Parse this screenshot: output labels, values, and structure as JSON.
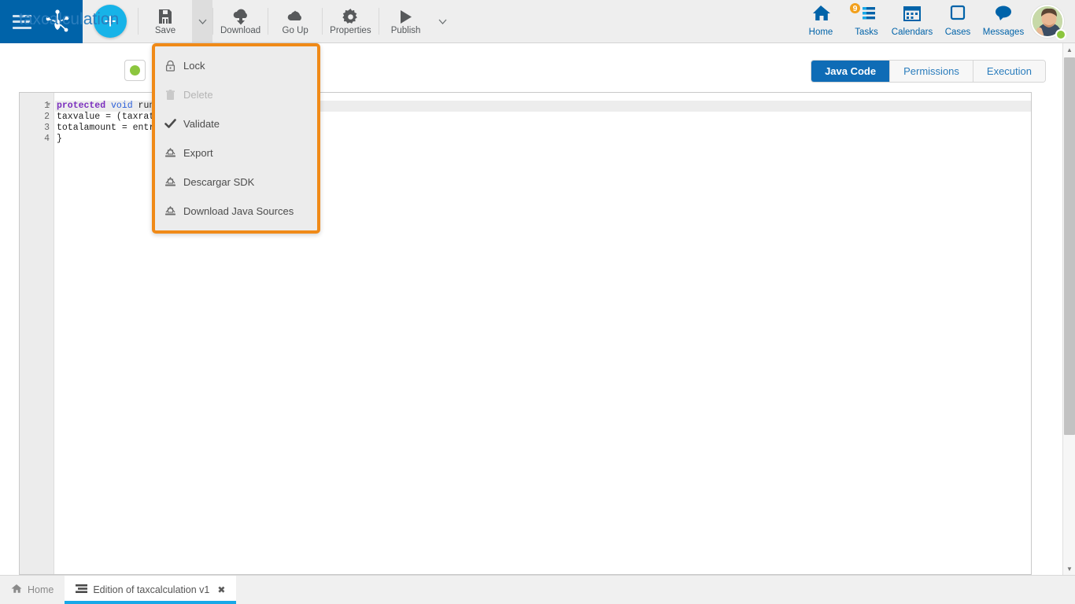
{
  "topbar": {
    "hamburger_label": "menu",
    "logo_label": "bizagi-logo",
    "add_label": "+",
    "buttons": [
      {
        "label": "Save",
        "icon": "save-icon"
      },
      {
        "label": "Download",
        "icon": "cloud-download-icon"
      },
      {
        "label": "Go Up",
        "icon": "cloud-upload-icon"
      },
      {
        "label": "Properties",
        "icon": "gear-icon"
      },
      {
        "label": "Publish",
        "icon": "play-icon"
      }
    ],
    "nav": [
      {
        "label": "Home",
        "icon": "home-icon",
        "badge": ""
      },
      {
        "label": "Tasks",
        "icon": "tasks-icon",
        "badge": "9"
      },
      {
        "label": "Calendars",
        "icon": "calendar-icon",
        "badge": ""
      },
      {
        "label": "Cases",
        "icon": "cases-icon",
        "badge": ""
      },
      {
        "label": "Messages",
        "icon": "message-icon",
        "badge": ""
      }
    ],
    "avatar_status": "online"
  },
  "page": {
    "title": "taxcalculation",
    "status_color": "#8cc63e",
    "tabs": [
      {
        "label": "Java Code",
        "active": true
      },
      {
        "label": "Permissions",
        "active": false
      },
      {
        "label": "Execution",
        "active": false
      }
    ]
  },
  "editor": {
    "line_numbers": [
      "1",
      "2",
      "3",
      "4"
    ],
    "lines": [
      "protected void run(",
      "taxvalue = (taxrate",
      "totalamount = entry",
      "}"
    ],
    "line1_tokens": {
      "kw": "protected",
      "ty": "void",
      "rest": " run("
    }
  },
  "menu": {
    "border_color": "#f08a18",
    "items": [
      {
        "label": "Lock",
        "icon": "lock-icon",
        "disabled": false
      },
      {
        "label": "Delete",
        "icon": "trash-icon",
        "disabled": true
      },
      {
        "label": "Validate",
        "icon": "check-icon",
        "disabled": false
      },
      {
        "label": "Export",
        "icon": "export-icon",
        "disabled": false
      },
      {
        "label": "Descargar SDK",
        "icon": "export-icon",
        "disabled": false
      },
      {
        "label": "Download Java Sources",
        "icon": "export-icon",
        "disabled": false
      }
    ]
  },
  "taskbar": {
    "items": [
      {
        "label": "Home",
        "icon": "home-icon",
        "active": false,
        "closable": false
      },
      {
        "label": "Edition of taxcalculation v1",
        "icon": "list-icon",
        "active": true,
        "closable": true
      }
    ],
    "close_glyph": "✖"
  },
  "scrollbar": {
    "up_glyph": "▲",
    "down_glyph": "▼"
  }
}
